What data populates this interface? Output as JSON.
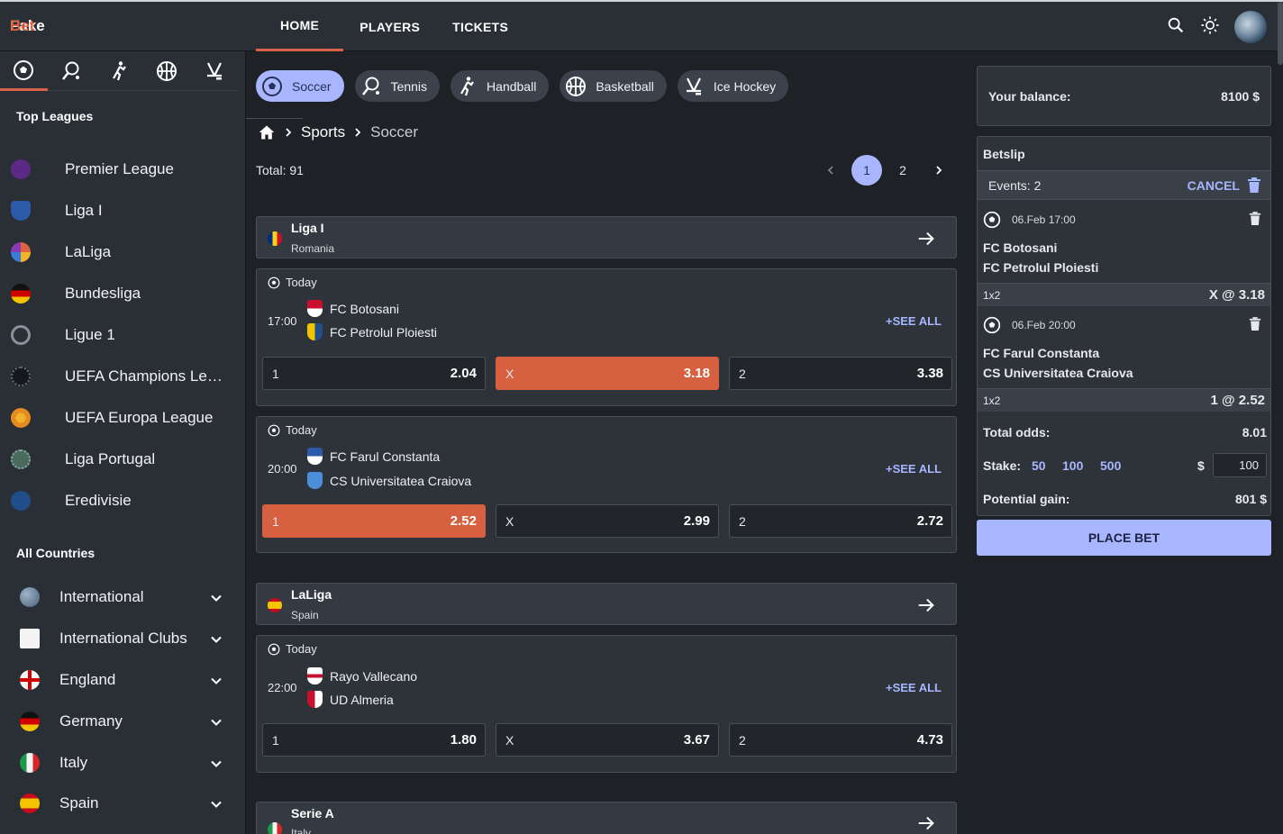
{
  "app": {
    "logo_fake": "Fake",
    "logo_bet": "Bet"
  },
  "nav": {
    "items": [
      "HOME",
      "PLAYERS",
      "TICKETS"
    ],
    "active": "HOME"
  },
  "sidebar": {
    "sport_tabs": [
      "soccer-icon",
      "tennis-icon",
      "handball-icon",
      "basketball-icon",
      "ice-hockey-icon"
    ],
    "top_leagues_heading": "Top Leagues",
    "leagues": [
      {
        "name": "Premier League",
        "color": "#5b2a86"
      },
      {
        "name": "Liga I",
        "color": "#2d5aa8"
      },
      {
        "name": "LaLiga",
        "color": "#e0623f"
      },
      {
        "name": "Bundesliga",
        "color": "#d00000"
      },
      {
        "name": "Ligue 1",
        "color": "#8a9099"
      },
      {
        "name": "UEFA Champions League",
        "color": "#1a1d22"
      },
      {
        "name": "UEFA Europa League",
        "color": "#e58a1f"
      },
      {
        "name": "Liga Portugal",
        "color": "#4a6b5c"
      },
      {
        "name": "Eredivisie",
        "color": "#1f4e8a"
      }
    ],
    "all_countries_heading": "All Countries",
    "countries": [
      {
        "name": "International"
      },
      {
        "name": "International Clubs"
      },
      {
        "name": "England"
      },
      {
        "name": "Germany"
      },
      {
        "name": "Italy"
      },
      {
        "name": "Spain"
      }
    ]
  },
  "chips": [
    {
      "label": "Soccer",
      "icon": "soccer-icon",
      "active": true
    },
    {
      "label": "Tennis",
      "icon": "tennis-icon",
      "active": false
    },
    {
      "label": "Handball",
      "icon": "handball-icon",
      "active": false
    },
    {
      "label": "Basketball",
      "icon": "basketball-icon",
      "active": false
    },
    {
      "label": "Ice Hockey",
      "icon": "ice-hockey-icon",
      "active": false
    }
  ],
  "breadcrumb": {
    "level1": "Sports",
    "level2": "Soccer"
  },
  "total": "Total: 91",
  "pager": {
    "current": "1",
    "next": "2"
  },
  "groups": [
    {
      "league": "Liga I",
      "country": "Romania",
      "matches": [
        {
          "day": "Today",
          "time": "17:00",
          "home": "FC Botosani",
          "away": "FC Petrolul Ploiesti",
          "see_all": "+SEE ALL",
          "odds": [
            {
              "label": "1",
              "value": "2.04"
            },
            {
              "label": "X",
              "value": "3.18"
            },
            {
              "label": "2",
              "value": "3.38"
            }
          ],
          "selected": "X"
        },
        {
          "day": "Today",
          "time": "20:00",
          "home": "FC Farul Constanta",
          "away": "CS Universitatea Craiova",
          "see_all": "+SEE ALL",
          "odds": [
            {
              "label": "1",
              "value": "2.52"
            },
            {
              "label": "X",
              "value": "2.99"
            },
            {
              "label": "2",
              "value": "2.72"
            }
          ],
          "selected": "1"
        }
      ]
    },
    {
      "league": "LaLiga",
      "country": "Spain",
      "matches": [
        {
          "day": "Today",
          "time": "22:00",
          "home": "Rayo Vallecano",
          "away": "UD Almeria",
          "see_all": "+SEE ALL",
          "odds": [
            {
              "label": "1",
              "value": "1.80"
            },
            {
              "label": "X",
              "value": "3.67"
            },
            {
              "label": "2",
              "value": "4.73"
            }
          ],
          "selected": ""
        }
      ]
    },
    {
      "league": "Serie A",
      "country": "Italy",
      "matches": []
    }
  ],
  "balance": {
    "label": "Your balance:",
    "value": "8100 $"
  },
  "betslip": {
    "title": "Betslip",
    "events": "Events: 2",
    "cancel": "CANCEL",
    "bets": [
      {
        "datetime": "06.Feb 17:00",
        "home": "FC Botosani",
        "away": "FC Petrolul Ploiesti",
        "market": "1x2",
        "pick": "X @ 3.18"
      },
      {
        "datetime": "06.Feb 20:00",
        "home": "FC Farul Constanta",
        "away": "CS Universitatea Craiova",
        "market": "1x2",
        "pick": "1 @ 2.52"
      }
    ],
    "total_odds_label": "Total odds:",
    "total_odds": "8.01",
    "stake_label": "Stake:",
    "stake_options": [
      "50",
      "100",
      "500"
    ],
    "currency": "$",
    "stake_value": "100",
    "gain_label": "Potential gain:",
    "gain": "801 $",
    "place_bet": "PLACE BET"
  },
  "colors": {
    "accent": "#a7b6ff",
    "selected_odd": "#d6603f",
    "brand": "#e0623f"
  }
}
